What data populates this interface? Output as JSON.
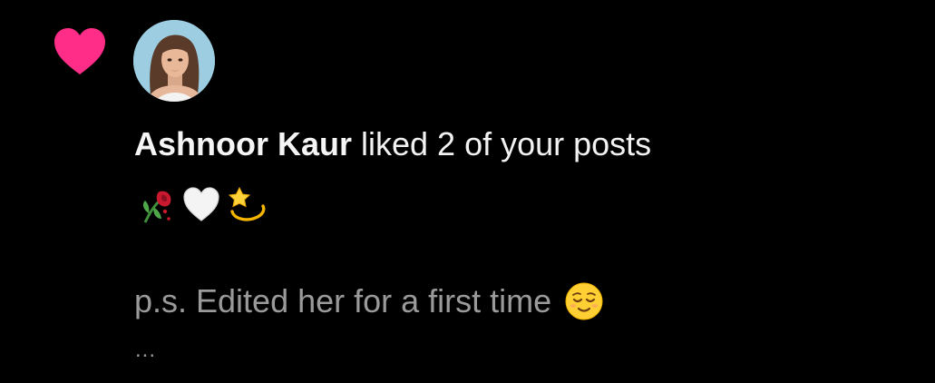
{
  "notification": {
    "username": "Ashnoor Kaur",
    "action_text": " liked 2 of your posts",
    "caption_text": "p.s. Edited her for a first time",
    "more_indicator": "...",
    "emojis": [
      "wilted-flower",
      "white-heart",
      "dizzy-star"
    ],
    "caption_emoji": "relieved-face"
  },
  "colors": {
    "background": "#000000",
    "heart": "#ff2d87",
    "primary_text": "#f2f2f2",
    "secondary_text": "#9a9a9a"
  }
}
